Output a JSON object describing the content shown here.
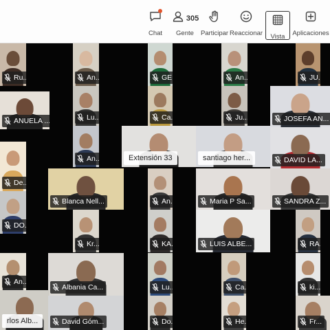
{
  "toolbar": {
    "chat_label": "Chat",
    "people_label": "Gente",
    "people_count": "305",
    "raise_label": "Participar",
    "react_label": "Reaccionar",
    "view_label": "Vista",
    "apps_label": "Aplicaciones"
  },
  "participants": [
    {
      "name": "Ru...",
      "muted": true
    },
    {
      "name": "An...",
      "muted": true
    },
    {
      "name": "GE...",
      "muted": true
    },
    {
      "name": "An...",
      "muted": true
    },
    {
      "name": "JU...",
      "muted": true
    },
    {
      "name": "ANUELA ...",
      "muted": true
    },
    {
      "name": "Lu...",
      "muted": true
    },
    {
      "name": "Ca...",
      "muted": true
    },
    {
      "name": "Ju...",
      "muted": true
    },
    {
      "name": "JOSEFA AN...",
      "muted": true
    },
    {
      "name": "An...",
      "muted": true
    },
    {
      "name": "Extensión 33",
      "muted": false
    },
    {
      "name": "santiago her...",
      "muted": false
    },
    {
      "name": "DAVID LA...",
      "muted": true
    },
    {
      "name": "De...",
      "muted": true
    },
    {
      "name": "Blanca Nell...",
      "muted": true
    },
    {
      "name": "An...",
      "muted": true
    },
    {
      "name": "Maria P Sa...",
      "muted": true
    },
    {
      "name": "SANDRA Z...",
      "muted": true
    },
    {
      "name": "DO...",
      "muted": true
    },
    {
      "name": "Kr...",
      "muted": true
    },
    {
      "name": "KA...",
      "muted": true
    },
    {
      "name": "LUIS ALBE...",
      "muted": true
    },
    {
      "name": "RA...",
      "muted": true
    },
    {
      "name": "An...",
      "muted": true
    },
    {
      "name": "Albania Ca...",
      "muted": true
    },
    {
      "name": "Lu...",
      "muted": true
    },
    {
      "name": "Ca...",
      "muted": true
    },
    {
      "name": "ki...",
      "muted": true
    },
    {
      "name": "rlos Alb...",
      "muted": false
    },
    {
      "name": "David Góm...",
      "muted": true
    },
    {
      "name": "Do...",
      "muted": true
    },
    {
      "name": "He...",
      "muted": true
    },
    {
      "name": "Fr...",
      "muted": true
    }
  ]
}
